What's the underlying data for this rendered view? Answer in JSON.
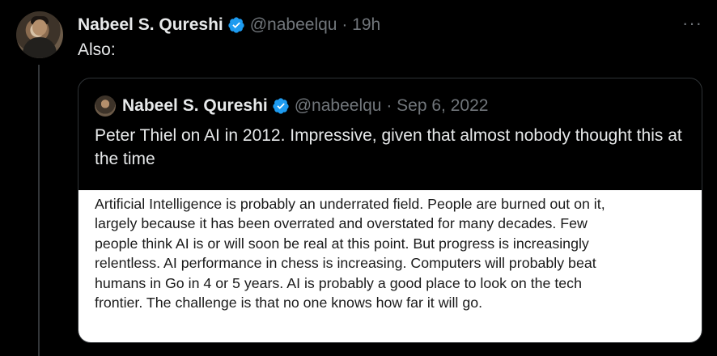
{
  "tweet": {
    "author_name": "Nabeel S. Qureshi",
    "handle": "@nabeelqu",
    "time": "19h",
    "text": "Also:",
    "verified_icon": "verified-badge-icon",
    "more_icon": "more-options-icon",
    "more_label": "···"
  },
  "quote": {
    "author_name": "Nabeel S. Qureshi",
    "handle": "@nabeelqu",
    "date": "Sep 6, 2022",
    "text": "Peter Thiel on AI in 2012. Impressive, given that almost nobody thought this at the time",
    "image_lines": [
      "Artificial Intelligence is probably an underrated field. People are burned out on it,",
      "largely because it has been overrated and overstated for many decades. Few",
      "people think AI is or will soon be real at this point. But progress is increasingly",
      "relentless. AI performance in chess is increasing. Computers will probably beat",
      "humans in Go in 4 or 5 years. AI is probably a good place to look on the tech",
      "frontier. The challenge is that no one knows how far it will go."
    ]
  },
  "colors": {
    "background": "#000000",
    "text": "#e7e9ea",
    "muted": "#71767b",
    "verified": "#1d9bf0",
    "border": "#2f3336"
  }
}
